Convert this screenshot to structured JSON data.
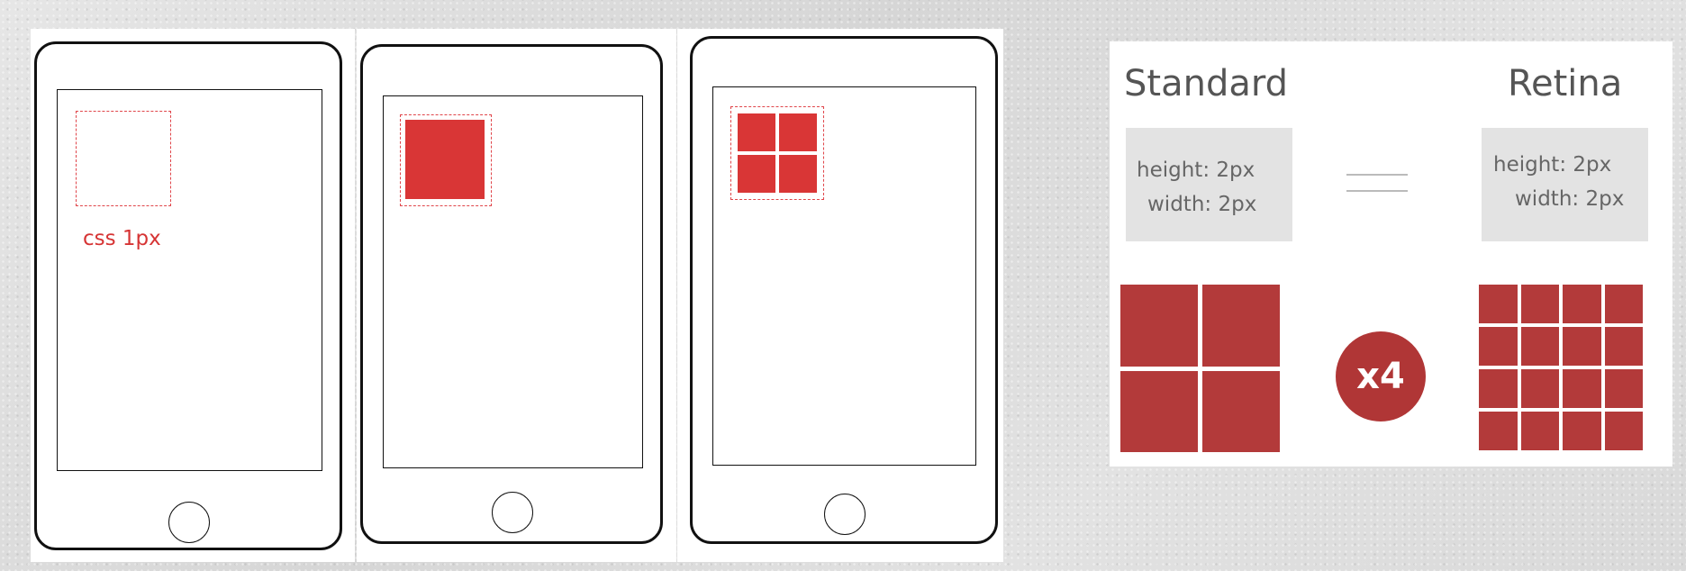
{
  "phones": [
    {
      "id": "phone-css-pixel",
      "label": "css 1px",
      "device_pixels_per_side": 0
    },
    {
      "id": "phone-standard",
      "device_pixels_per_side": 1
    },
    {
      "id": "phone-retina",
      "device_pixels_per_side": 2
    }
  ],
  "comparison": {
    "standard": {
      "heading": "Standard",
      "height_text": "height: 2px",
      "width_text": "width: 2px",
      "grid_per_side": 2
    },
    "retina": {
      "heading": "Retina",
      "height_text": "height: 2px",
      "width_text": "width: 2px",
      "grid_per_side": 4
    },
    "multiplier_label": "x4"
  },
  "colors": {
    "pixel_red": "#d93636",
    "grid_red": "#b33a3a",
    "badge_red": "#b03636",
    "dashed_outline": "#e0454a",
    "label_red": "#d63434"
  }
}
